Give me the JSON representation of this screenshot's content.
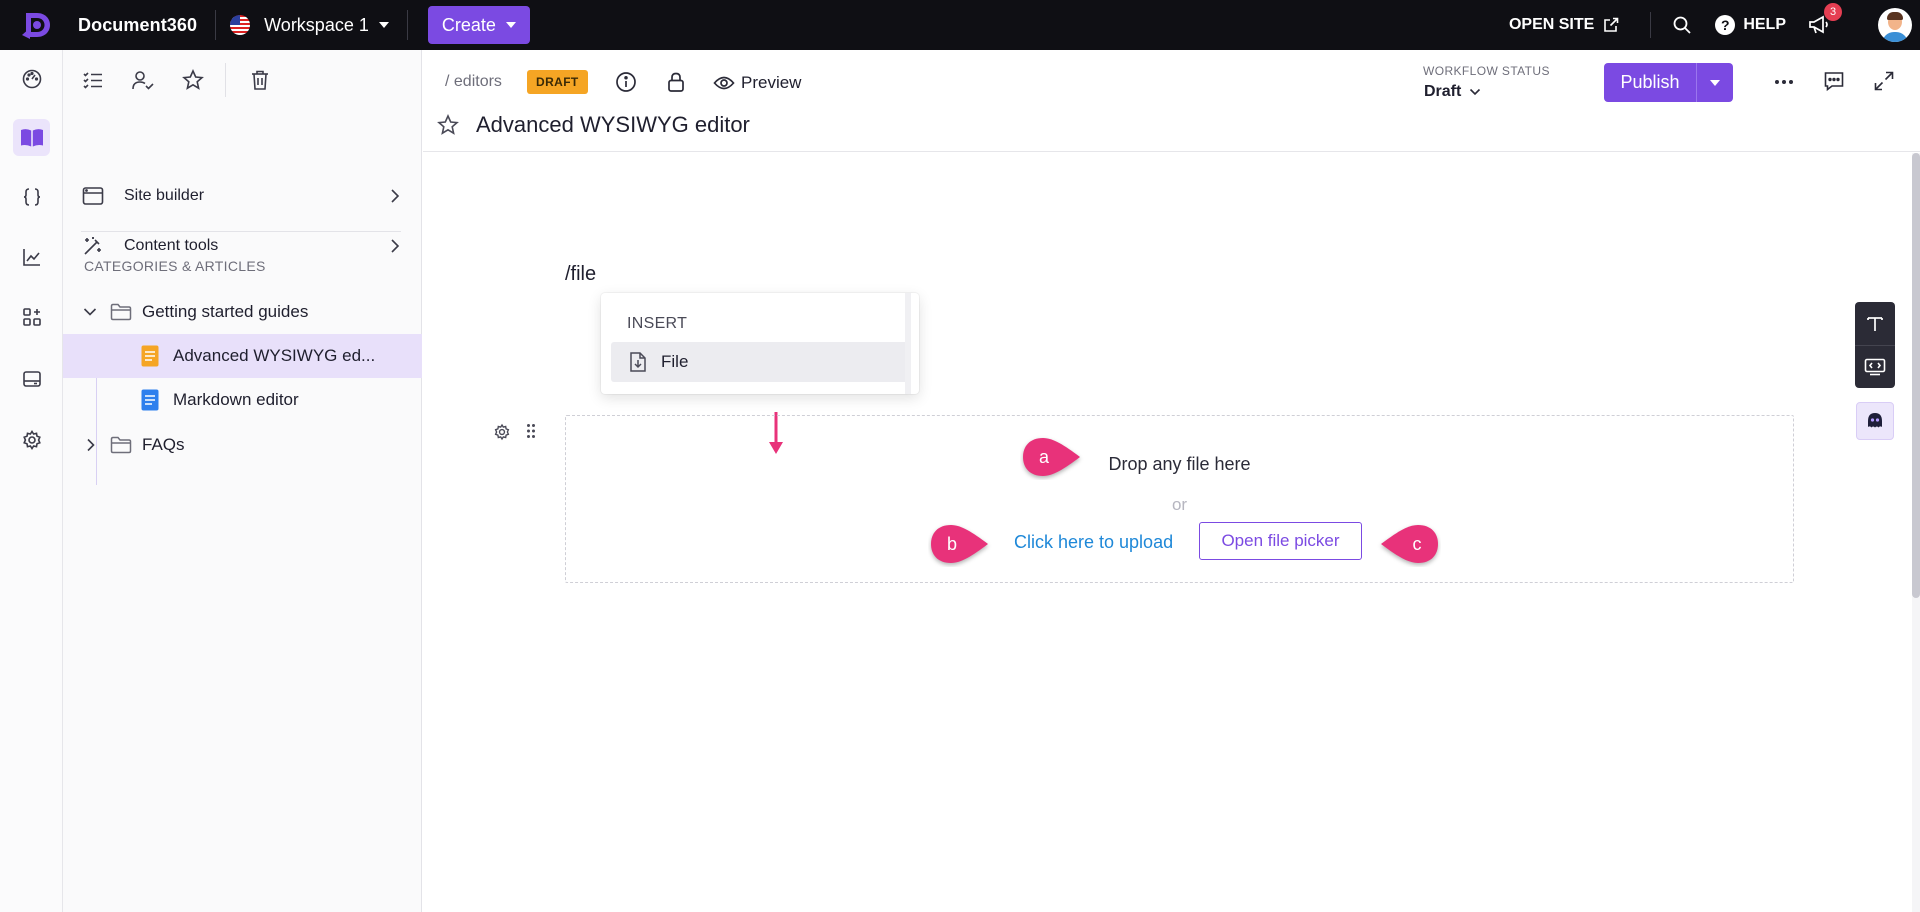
{
  "topbar": {
    "brand": "Document360",
    "workspace": "Workspace 1",
    "create_label": "Create",
    "open_site": "OPEN SITE",
    "help": "HELP",
    "notification_count": "3"
  },
  "sidebar": {
    "menu": [
      {
        "label": "Site builder"
      },
      {
        "label": "Content tools"
      }
    ],
    "section_title": "CATEGORIES & ARTICLES",
    "tree": [
      {
        "label": "Getting started guides"
      },
      {
        "label": "Advanced WYSIWYG ed..."
      },
      {
        "label": "Markdown editor"
      },
      {
        "label": "FAQs"
      }
    ]
  },
  "header": {
    "breadcrumb": "/ editors",
    "badge": "DRAFT",
    "preview": "Preview",
    "title": "Advanced WYSIWYG editor",
    "workflow_label": "WORKFLOW STATUS",
    "workflow_value": "Draft",
    "publish_label": "Publish"
  },
  "editor": {
    "slash_command": "/file",
    "insert_menu": {
      "header": "INSERT",
      "item": "File"
    },
    "dropzone": {
      "drop_text": "Drop any file here",
      "or_text": "or",
      "upload_link": "Click here to upload",
      "picker_button": "Open file picker"
    },
    "callouts": [
      "a",
      "b",
      "c"
    ]
  },
  "colors": {
    "accent": "#7b4ae2",
    "topbar": "#0f0f14",
    "callout": "#e8327a",
    "link": "#1e88d8",
    "draft_badge": "#f5a524"
  }
}
